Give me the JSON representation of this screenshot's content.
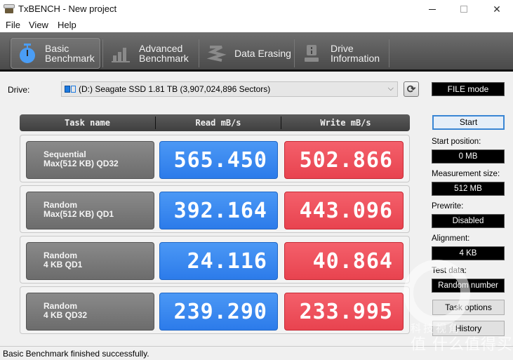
{
  "window": {
    "title": "TxBENCH - New project",
    "minimize_icon": "minimize-icon",
    "maximize_icon": "maximize-icon",
    "close_glyph": "✕"
  },
  "menu": [
    "File",
    "View",
    "Help"
  ],
  "tabs": [
    {
      "line1": "Basic",
      "line2": "Benchmark",
      "icon": "stopwatch-icon",
      "active": true
    },
    {
      "line1": "Advanced",
      "line2": "Benchmark",
      "icon": "bar-chart-icon",
      "active": false
    },
    {
      "line1": "Data Erasing",
      "line2": "",
      "icon": "eraser-icon",
      "active": false
    },
    {
      "line1": "Drive",
      "line2": "Information",
      "icon": "drive-info-icon",
      "active": false
    }
  ],
  "drive": {
    "label": "Drive:",
    "selected": "(D:) Seagate SSD  1.81 TB (3,907,024,896 Sectors)",
    "chevron": "⌵",
    "refresh_glyph": "⟳",
    "mode": "FILE mode"
  },
  "table": {
    "headers": [
      "Task name",
      "Read mB/s",
      "Write mB/s"
    ],
    "rows": [
      {
        "task_line1": "Sequential",
        "task_line2": "Max(512 KB) QD32",
        "read": "565.450",
        "write": "502.866"
      },
      {
        "task_line1": "Random",
        "task_line2": "Max(512 KB) QD1",
        "read": "392.164",
        "write": "443.096"
      },
      {
        "task_line1": "Random",
        "task_line2": "4 KB QD1",
        "read": "24.116",
        "write": "40.864"
      },
      {
        "task_line1": "Random",
        "task_line2": "4 KB QD32",
        "read": "239.290",
        "write": "233.995"
      }
    ]
  },
  "panel": {
    "start_label": "Start",
    "start_position_label": "Start position:",
    "start_position_value": "0 MB",
    "measurement_size_label": "Measurement size:",
    "measurement_size_value": "512 MB",
    "prewrite_label": "Prewrite:",
    "prewrite_value": "Disabled",
    "alignment_label": "Alignment:",
    "alignment_value": "4 KB",
    "test_data_label": "Test data:",
    "test_data_value": "Random number",
    "task_options_label": "Task options",
    "history_label": "History"
  },
  "status": {
    "text": "Basic Benchmark finished successfully."
  },
  "watermark": {
    "line1": "科技视角",
    "line2": "值 什么值得买"
  },
  "colors": {
    "read": "#3b8af0",
    "write": "#ee505b",
    "accent": "#3a86d4"
  }
}
